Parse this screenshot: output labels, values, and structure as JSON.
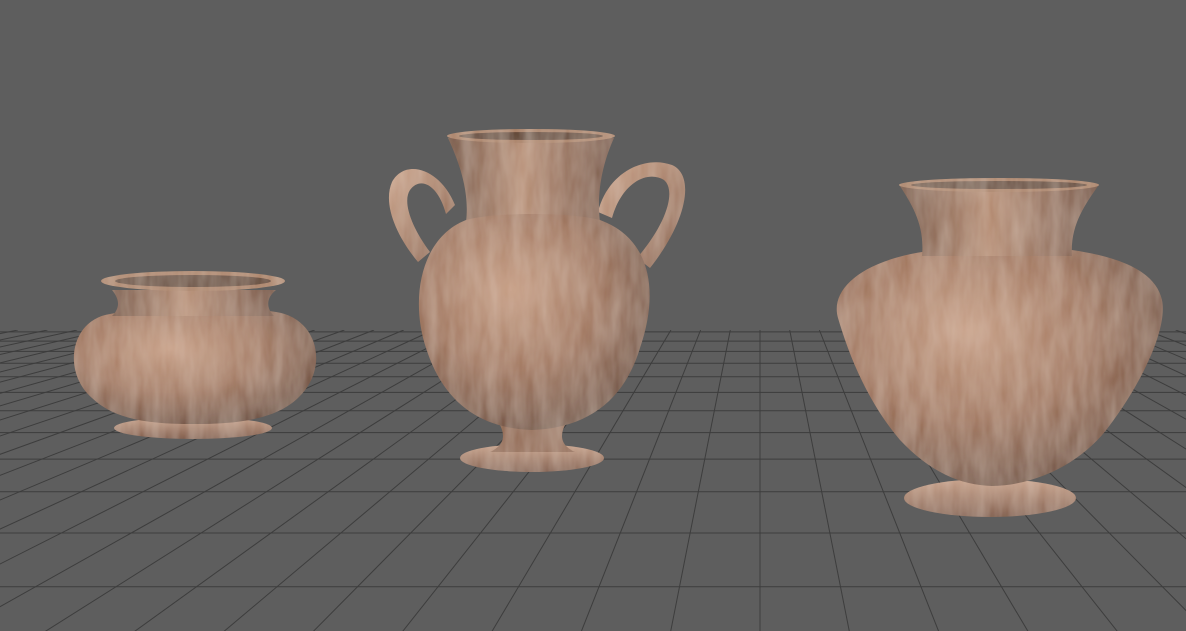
{
  "viewport": {
    "background_color": "#5e5e5e",
    "grid_color": "#3d3d3d",
    "grid_visible": true,
    "camera": "perspective"
  },
  "objects": [
    {
      "name": "squat-bowl-pot",
      "kind": "pot",
      "handles": 0
    },
    {
      "name": "two-handled-amphora",
      "kind": "amphora",
      "handles": 2
    },
    {
      "name": "wide-shoulder-vase",
      "kind": "vase",
      "handles": 0
    }
  ],
  "material": {
    "base_color": "#9a6f55",
    "highlight_color": "#d9b79e",
    "shadow_color": "#4f3425"
  }
}
